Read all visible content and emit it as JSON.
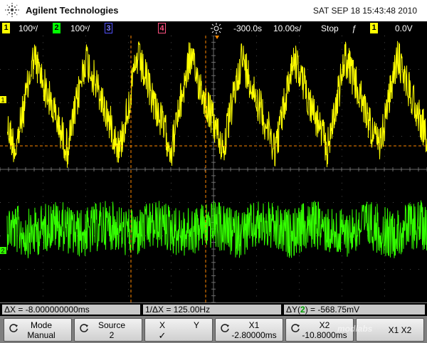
{
  "header": {
    "brand": "Agilent Technologies",
    "datetime": "SAT SEP 18 15:43:48 2010"
  },
  "status": {
    "ch1_num": "1",
    "ch1_scale": "100ᵛ/",
    "ch2_num": "2",
    "ch2_scale": "100ᵛ/",
    "ch3_num": "3",
    "ch4_num": "4",
    "time_offset": "-300.0ѕ",
    "time_scale": "10.00ѕ/",
    "run_state": "Stop",
    "trigger_edge": "ƒ",
    "trigger_source": "1",
    "trigger_level": "0.0V",
    "colors": {
      "ch1": "#ffff00",
      "ch2": "#00ff00",
      "ch3": "#5050ff",
      "ch4": "#ff5080"
    }
  },
  "screen": {
    "ch1_marker": "1",
    "ch2_marker": "2",
    "ch1_color": "#ffff00",
    "ch2_color": "#33ff00",
    "cursor_color": "#ff8800"
  },
  "measurements": {
    "delta_x": "ΔX = -8.000000000ms",
    "inv_delta_x": "1/ΔX = 125.00Hz",
    "delta_y_prefix": "ΔY(",
    "delta_y_channel": "2",
    "delta_y_suffix": ") = -568.75mV"
  },
  "softkeys": {
    "mode_label": "Mode",
    "mode_value": "Manual",
    "source_label": "Source",
    "source_value": "2",
    "x_label": "X",
    "x_check": "✓",
    "y_label": "Y",
    "x1_label": "X1",
    "x1_value": "-2.80000ms",
    "x2_label": "X2",
    "x2_value": "-10.8000ms",
    "x1x2_label": "X1 X2",
    "watermark": "modlabs"
  }
}
